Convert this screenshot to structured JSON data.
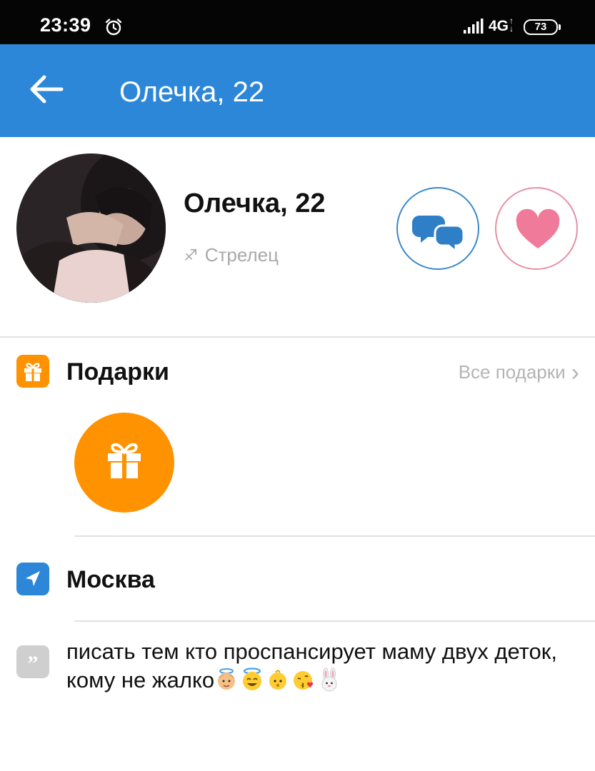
{
  "status_bar": {
    "time": "23:39",
    "network": "4G",
    "battery": "73"
  },
  "app_bar": {
    "title": "Олечка, 22"
  },
  "profile": {
    "name": "Олечка, 22",
    "zodiac_symbol": "♐",
    "zodiac": "Стрелец"
  },
  "gifts": {
    "title": "Подарки",
    "see_all": "Все подарки",
    "chevron": "›"
  },
  "location": {
    "city": "Москва"
  },
  "status": {
    "text": "писать тем кто проспансирует маму двух деток, кому не жалко"
  },
  "icons": {
    "alarm": "alarm-icon",
    "signal": "signal-icon",
    "back": "arrow-left-icon",
    "chat": "chat-bubbles-icon",
    "like": "heart-icon",
    "gift": "gift-icon",
    "location": "location-arrow-icon",
    "quote": "quote-icon",
    "emojis": [
      "angel-boy-emoji",
      "smiling-halo-emoji",
      "baby-emoji",
      "kiss-emoji",
      "rabbit-emoji"
    ]
  },
  "colors": {
    "app_bar": "#2d87d8",
    "chat_accent": "#3a88cc",
    "like_accent": "#f07a9a",
    "gift_orange": "#ff9200",
    "location_blue": "#2d87d8",
    "secondary_text": "#a9a9a9"
  }
}
